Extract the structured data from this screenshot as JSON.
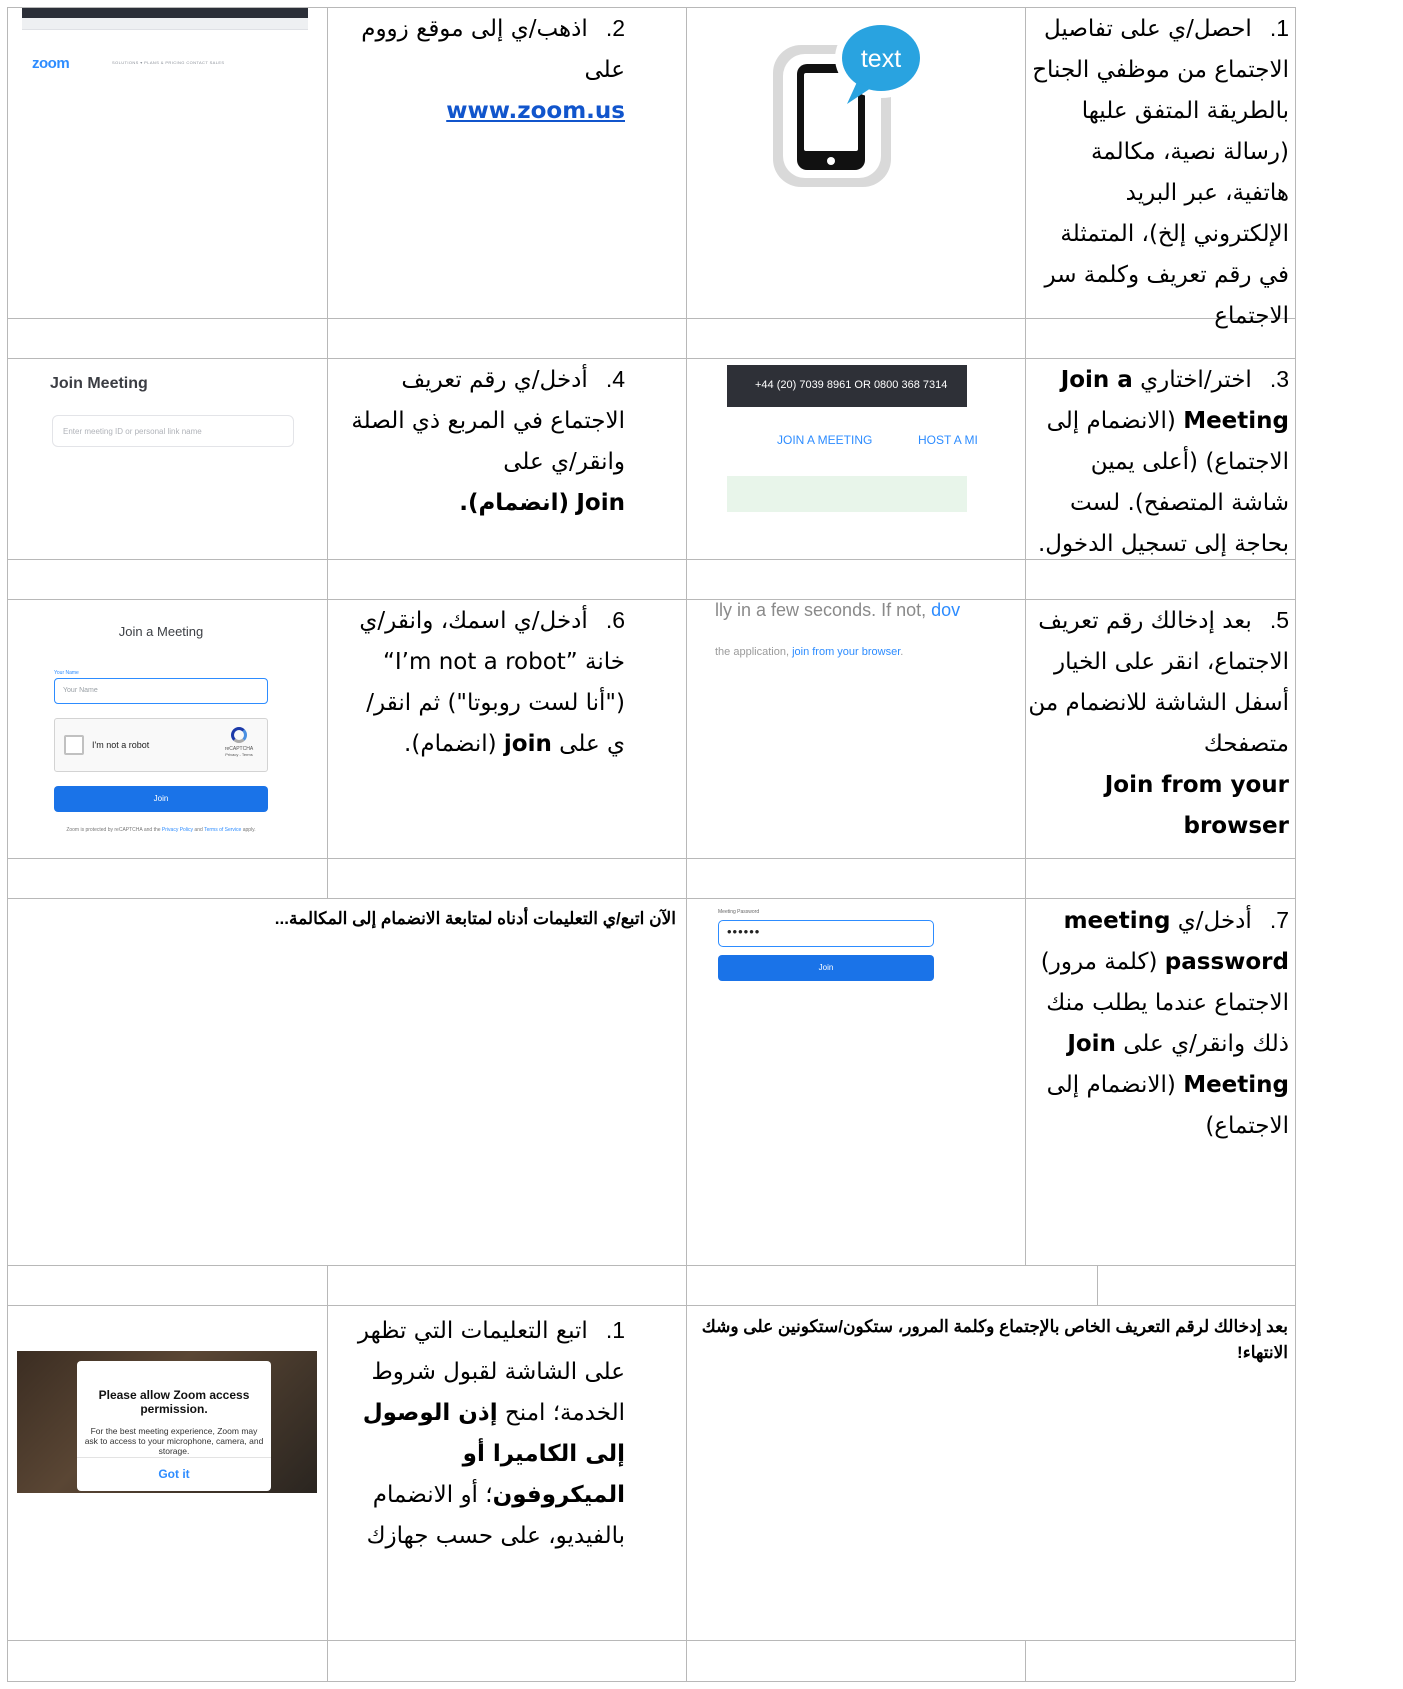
{
  "steps": {
    "s1": {
      "number": "1.",
      "text": "احصل/ي على تفاصيل الاجتماع من موظفي الجناح بالطريقة المتفق عليها (رسالة نصية، مكالمة هاتفية، عبر البريد الإلكتروني إلخ)، المتمثلة في رقم تعريف وكلمة سر الاجتماع"
    },
    "s2": {
      "number": "2.",
      "text": "اذهب/ي إلى موقع زووم على",
      "link": "www.zoom.us"
    },
    "s3": {
      "number": "3.",
      "pre": "اختر/اختاري",
      "bold": "Join a Meeting",
      "post": "(الانضمام إلى الاجتماع) (أعلى يمين شاشة المتصفح). لست بحاجة إلى تسجيل الدخول."
    },
    "s4": {
      "number": "4.",
      "text": "أدخل/ي رقم تعريف الاجتماع في المربع ذي الصلة وانقر/ي على",
      "bold": "Join",
      "bold_ar": "(انضمام)."
    },
    "s5": {
      "number": "5.",
      "text": "بعد إدخالك رقم تعريف الاجتماع، انقر على الخيار أسفل الشاشة للانضمام من متصفحك",
      "bold": "Join from your browser"
    },
    "s6": {
      "number": "6.",
      "pre": "أدخل/ي اسمك، وانقر/ي خانة",
      "quote": "“I’m not a robot”",
      "mid": "(\"أنا لست روبوتا\") ثم انقر/ي على",
      "bold": "join",
      "post": "(انضمام)."
    },
    "s7": {
      "number": "7.",
      "pre": "أدخل/ي",
      "bold1": "meeting password",
      "mid": "(كلمة مرور) الاجتماع عندما يطلب منك ذلك وانقر/ي على",
      "bold2": "Join Meeting",
      "post": "(الانضمام إلى الاجتماع)"
    },
    "b1": {
      "number": "1.",
      "pre": "اتبع التعليمات التي تظهر على الشاشة لقبول شروط الخدمة؛ امنح",
      "bold": "إذن الوصول إلى الكاميرا أو الميكروفون",
      "post": "؛ أو الانضمام بالفيديو، على حسب جهازك"
    }
  },
  "notes": {
    "follow": "الآن اتبع/ي التعليمات أدناه لمتابعة الانضمام إلى المكالمة...",
    "after": "بعد إدخالك لرقم التعريف الخاص بالإجتماع وكلمة المرور، ستكون/ستكونين على وشك الانتهاء!"
  },
  "images": {
    "zoom_site": {
      "logo": "zoom",
      "menu": "SOLUTIONS ▾    PLANS & PRICING    CONTACT SALES"
    },
    "text_icon": {
      "bubble": "text"
    },
    "join_meeting": {
      "title": "Join Meeting",
      "placeholder": "Enter meeting ID or personal link name"
    },
    "zoom_nav": {
      "phone": "+44 (20) 7039 8961 OR 0800 368 7314",
      "join": "JOIN A MEETING",
      "host": "HOST A MI"
    },
    "browser_join": {
      "line1_pre": "lly in a few seconds. If not, ",
      "line1_link": "dov",
      "line2_pre": "the application, ",
      "line2_link": "join from your browser",
      "line2_post": "."
    },
    "join_form": {
      "title": "Join a Meeting",
      "name_label": "Your Name",
      "name_placeholder": "Your Name",
      "robot": "I'm not a robot",
      "recaptcha": "reCAPTCHA",
      "privacy_terms": "Privacy - Terms",
      "button": "Join",
      "footer_pre": "Zoom is protected by reCAPTCHA and the ",
      "footer_privacy": "Privacy Policy",
      "footer_and": " and ",
      "footer_terms": "Terms of Service",
      "footer_post": " apply."
    },
    "password": {
      "label": "Meeting Password",
      "value": "••••••",
      "button": "Join"
    },
    "permission": {
      "title": "Please allow Zoom access permission.",
      "body": "For the best meeting experience, Zoom may ask to access to your microphone, camera, and storage.",
      "button": "Got it"
    }
  },
  "colors": {
    "border": "#b8b8b8",
    "link": "#1155cc",
    "zoom_blue": "#2d8cff",
    "button_blue": "#1a73e8",
    "nav_dark": "#2e3037",
    "nav_green": "#e8f5ea"
  }
}
